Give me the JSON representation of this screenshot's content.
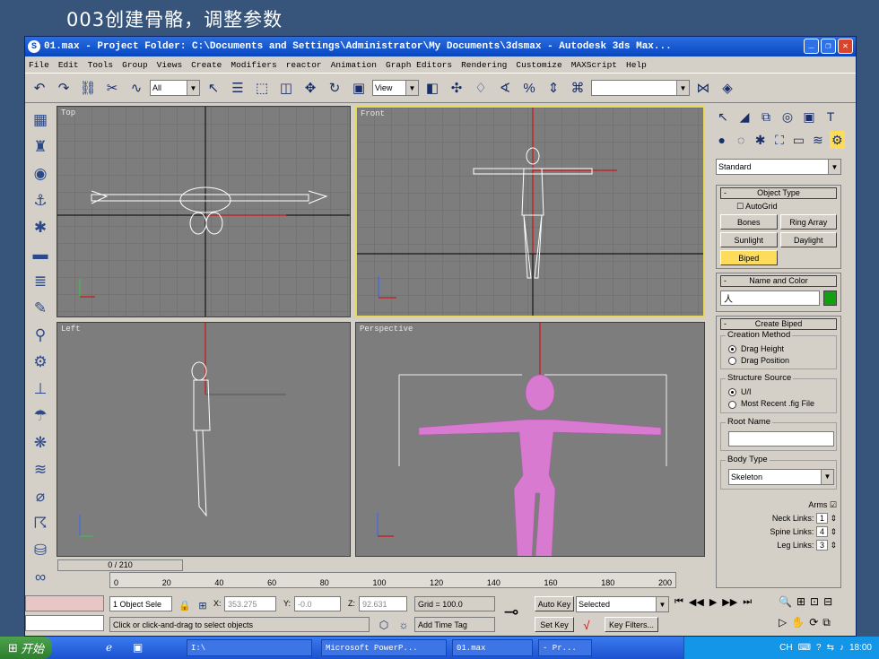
{
  "slide": {
    "title": "003创建骨骼，调整参数"
  },
  "window": {
    "title": "01.max    - Project Folder: C:\\Documents and Settings\\Administrator\\My Documents\\3dsmax     - Autodesk 3ds Max...",
    "icon": "3ds-max-icon"
  },
  "menu": [
    "File",
    "Edit",
    "Tools",
    "Group",
    "Views",
    "Create",
    "Modifiers",
    "reactor",
    "Animation",
    "Graph Editors",
    "Rendering",
    "Customize",
    "MAXScript",
    "Help"
  ],
  "toolbar": {
    "selection_filter": "All",
    "ref_coord": "View"
  },
  "viewports": {
    "top": "Top",
    "front": "Front",
    "left": "Left",
    "perspective": "Perspective"
  },
  "command_panel": {
    "category": "Standard",
    "object_type": {
      "header": "Object Type",
      "autogrid": "AutoGrid",
      "buttons": [
        "Bones",
        "Ring Array",
        "Sunlight",
        "Daylight"
      ],
      "selected": "Biped"
    },
    "name_color": {
      "header": "Name and Color",
      "name": "人",
      "color": "#12a012"
    },
    "create_biped": {
      "header": "Create Biped",
      "creation_method": "Creation Method",
      "drag_height": "Drag Height",
      "drag_position": "Drag Position",
      "structure_source": "Structure Source",
      "ui": "U/I",
      "most_recent": "Most Recent .fig File",
      "root_name": "Root Name",
      "body_type": "Body Type",
      "body_type_value": "Skeleton",
      "arms": "Arms",
      "neck_links": "Neck Links:",
      "neck_links_val": "1",
      "spine_links": "Spine Links:",
      "spine_links_val": "4",
      "leg_links": "Leg Links:",
      "leg_links_val": "3"
    }
  },
  "timeline": {
    "frame": "0 / 210",
    "ticks": [
      "0",
      "20",
      "40",
      "60",
      "80",
      "100",
      "120",
      "140",
      "160",
      "180",
      "200"
    ]
  },
  "status": {
    "selected": "1 Object Sele",
    "x": "353.275",
    "y": "-0.0",
    "z": "92.631",
    "grid": "Grid = 100.0",
    "prompt": "Click or click-and-drag to select objects",
    "add_time_tag": "Add Time Tag",
    "auto_key": "Auto Key",
    "selected_dd": "Selected",
    "set_key": "Set Key",
    "key_filters": "Key Filters...",
    "x_label": "X:",
    "y_label": "Y:",
    "z_label": "Z:"
  },
  "taskbar": {
    "start": "开始",
    "tasks": [
      "I:\\",
      "Microsoft PowerP...",
      "01.max",
      "- Pr..."
    ],
    "clock": "18:00",
    "tray_lang": "CH"
  }
}
